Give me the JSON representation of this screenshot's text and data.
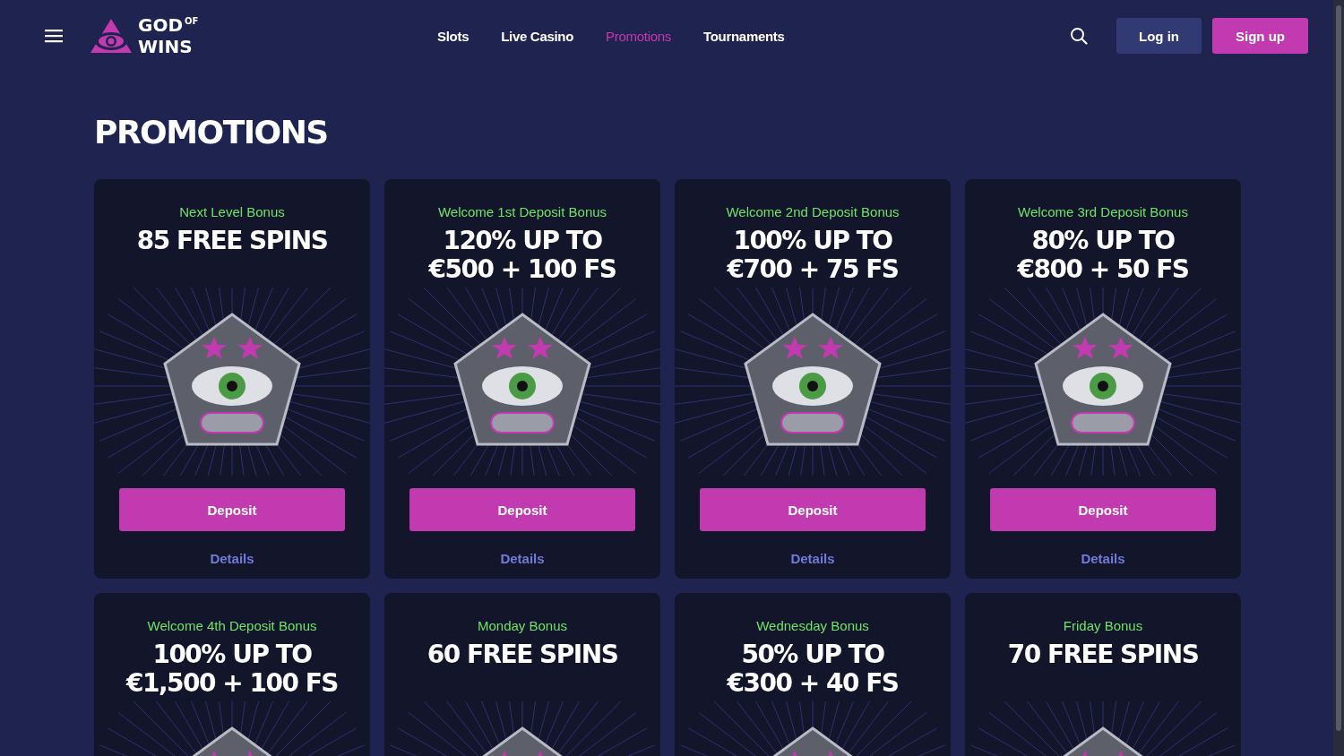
{
  "header": {
    "logo": {
      "main": "GOD",
      "sup": "OF",
      "second": "WINS"
    },
    "nav": [
      {
        "label": "Slots",
        "selected": false
      },
      {
        "label": "Live Casino",
        "selected": false
      },
      {
        "label": "Promotions",
        "selected": true
      },
      {
        "label": "Tournaments",
        "selected": false
      }
    ],
    "login": "Log in",
    "signup": "Sign up"
  },
  "page_title": "PROMOTIONS",
  "promotions": [
    {
      "subtitle": "Next Level Bonus",
      "headline": [
        "85 FREE SPINS"
      ],
      "deposit": "Deposit",
      "details": "Details"
    },
    {
      "subtitle": "Welcome 1st Deposit Bonus",
      "headline": [
        "120% UP TO",
        "€500 + 100 FS"
      ],
      "deposit": "Deposit",
      "details": "Details"
    },
    {
      "subtitle": "Welcome 2nd Deposit Bonus",
      "headline": [
        "100% UP TO",
        "€700 + 75 FS"
      ],
      "deposit": "Deposit",
      "details": "Details"
    },
    {
      "subtitle": "Welcome 3rd Deposit Bonus",
      "headline": [
        "80% UP TO",
        "€800 + 50 FS"
      ],
      "deposit": "Deposit",
      "details": "Details"
    },
    {
      "subtitle": "Welcome 4th Deposit Bonus",
      "headline": [
        "100% UP TO",
        "€1,500 + 100 FS"
      ]
    },
    {
      "subtitle": "Monday Bonus",
      "headline": [
        "60 FREE SPINS"
      ]
    },
    {
      "subtitle": "Wednesday Bonus",
      "headline": [
        "50% UP TO",
        "€300 + 40 FS"
      ]
    },
    {
      "subtitle": "Friday Bonus",
      "headline": [
        "70 FREE SPINS"
      ]
    }
  ]
}
